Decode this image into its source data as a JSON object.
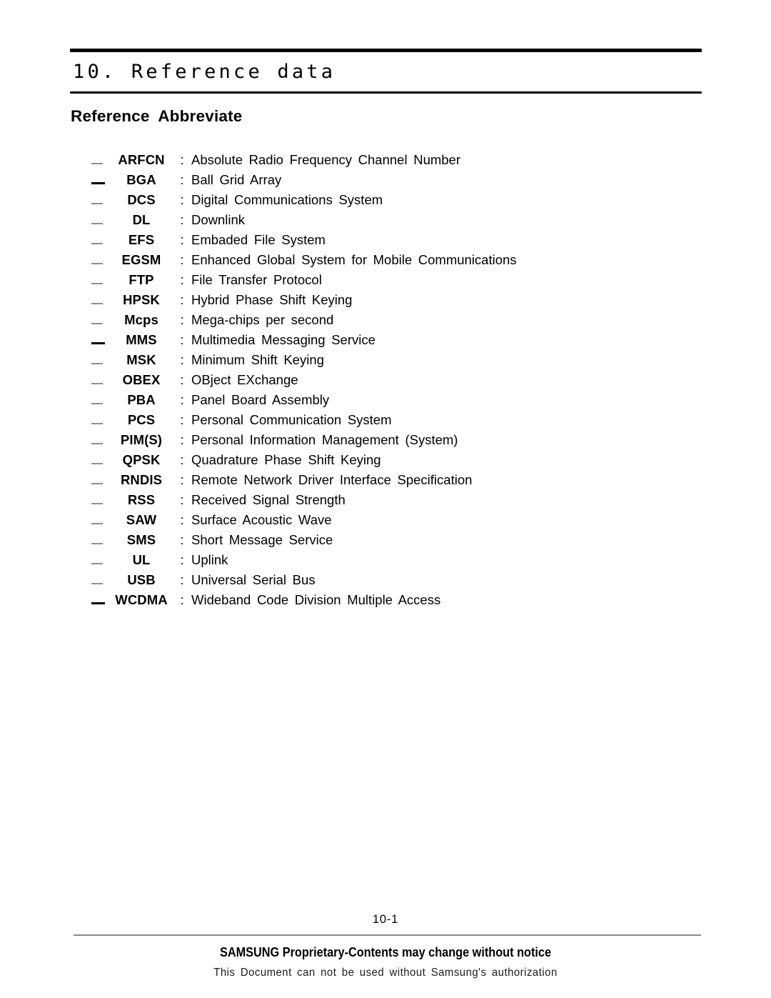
{
  "chapter": {
    "title": "10. Reference data"
  },
  "section": {
    "heading": "Reference  Abbreviate"
  },
  "abbreviations": [
    {
      "marker": "dash-thin",
      "term": "ARFCN",
      "colon": ":",
      "definition": "Absolute Radio Frequency Channel Number"
    },
    {
      "marker": "dash-bold",
      "term": "BGA",
      "colon": ":",
      "definition": "Ball Grid Array"
    },
    {
      "marker": "dash-thin",
      "term": "DCS",
      "colon": ":",
      "definition": "Digital Communications System"
    },
    {
      "marker": "dash-thin",
      "term": "DL",
      "colon": ":",
      "definition": "Downlink"
    },
    {
      "marker": "dash-thin",
      "term": "EFS",
      "colon": ":",
      "definition": "Embaded File System"
    },
    {
      "marker": "dash-thin",
      "term": "EGSM",
      "colon": ":",
      "definition": "Enhanced Global System for Mobile Communications"
    },
    {
      "marker": "dash-thin",
      "term": "FTP",
      "colon": ":",
      "definition": "File Transfer Protocol"
    },
    {
      "marker": "dash-thin",
      "term": "HPSK",
      "colon": ":",
      "definition": "Hybrid Phase Shift Keying"
    },
    {
      "marker": "dash-thin",
      "term": "Mcps",
      "colon": ":",
      "definition": "Mega-chips per second"
    },
    {
      "marker": "dash-bold",
      "term": "MMS",
      "colon": ":",
      "definition": "Multimedia Messaging Service"
    },
    {
      "marker": "dash-thin",
      "term": "MSK",
      "colon": ":",
      "definition": "Minimum Shift Keying"
    },
    {
      "marker": "dash-thin",
      "term": "OBEX",
      "colon": ":",
      "definition": "OBject EXchange"
    },
    {
      "marker": "dash-thin",
      "term": "PBA",
      "colon": ":",
      "definition": "Panel Board Assembly"
    },
    {
      "marker": "dash-thin",
      "term": "PCS",
      "colon": ":",
      "definition": "Personal Communication System"
    },
    {
      "marker": "dash-thin",
      "term": "PIM(S)",
      "colon": ":",
      "definition": "Personal Information Management (System)"
    },
    {
      "marker": "dash-thin",
      "term": "QPSK",
      "colon": ":",
      "definition": "Quadrature Phase Shift Keying"
    },
    {
      "marker": "dash-thin",
      "term": "RNDIS",
      "colon": ":",
      "definition": "Remote Network Driver Interface Specification"
    },
    {
      "marker": "dash-thin",
      "term": "RSS",
      "colon": ":",
      "definition": "Received Signal Strength"
    },
    {
      "marker": "dash-thin",
      "term": "SAW",
      "colon": ":",
      "definition": "Surface Acoustic Wave"
    },
    {
      "marker": "dash-thin",
      "term": "SMS",
      "colon": ":",
      "definition": "Short Message Service"
    },
    {
      "marker": "dash-thin",
      "term": "UL",
      "colon": ":",
      "definition": "Uplink"
    },
    {
      "marker": "dash-thin",
      "term": "USB",
      "colon": ":",
      "definition": "Universal Serial Bus"
    },
    {
      "marker": "dash-bold",
      "term": "WCDMA",
      "colon": ":",
      "definition": "Wideband Code Division Multiple Access"
    }
  ],
  "footer": {
    "page_number": "10-1",
    "notice": "SAMSUNG Proprietary-Contents may change without notice",
    "authorization": "This Document can not be used without Samsung's authorization"
  },
  "colors": {
    "text": "#000000",
    "rule_dark": "#000000",
    "rule_light": "#8a8a8a",
    "dash_thin": "#8e8e8e"
  }
}
